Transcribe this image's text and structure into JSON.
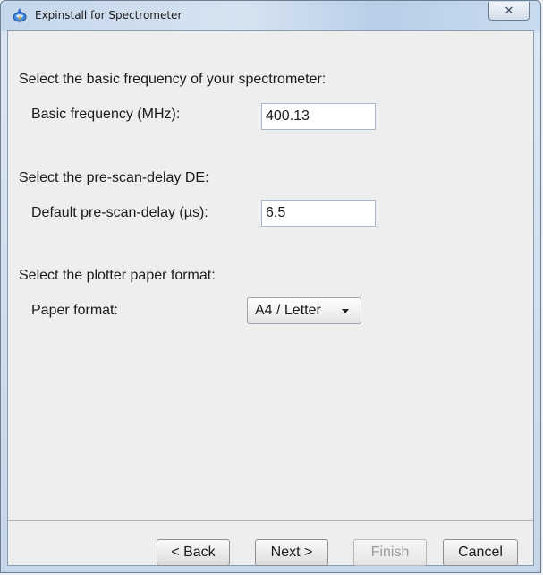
{
  "window": {
    "title": "Expinstall for Spectrometer",
    "close_symbol": "✕"
  },
  "frequency": {
    "heading": "Select the basic frequency of your spectrometer:",
    "label": "Basic frequency (MHz):",
    "value": "400.13"
  },
  "delay": {
    "heading": "Select the pre-scan-delay DE:",
    "label": "Default pre-scan-delay (µs):",
    "value": "6.5"
  },
  "paper": {
    "heading": "Select the plotter paper format:",
    "label": "Paper format:",
    "selected": "A4 / Letter"
  },
  "buttons": {
    "back": "< Back",
    "next": "Next >",
    "finish": "Finish",
    "cancel": "Cancel"
  },
  "icons": {
    "app": "spectrometer-app-icon",
    "close": "close-icon",
    "dropdown": "chevron-down-icon"
  }
}
